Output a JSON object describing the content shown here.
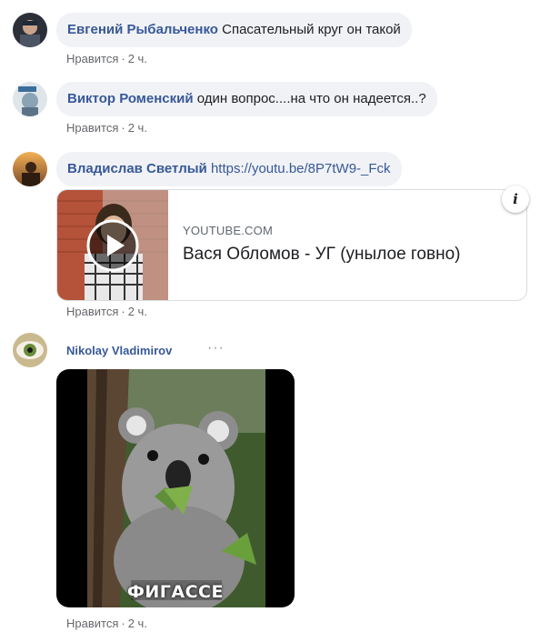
{
  "comments": [
    {
      "author": "Евгений Рыбальченко",
      "text": "Спасательный круг он такой",
      "like": "Нравится",
      "sep": "·",
      "time": "2 ч."
    },
    {
      "author": "Виктор Роменский",
      "text": "один вопрос....на что он надеется..?",
      "like": "Нравится",
      "sep": "·",
      "time": "2 ч.",
      "avatar_badge": "# ЗА МИР"
    },
    {
      "author": "Владислав Светлый",
      "link": "https://youtu.be/8P7tW9-_Fck",
      "like": "Нравится",
      "sep": "·",
      "time": "2 ч.",
      "preview": {
        "domain": "YOUTUBE.COM",
        "title": "Вася Обломов - УГ (унылое говно)",
        "info_icon": "i",
        "play_icon": "play-icon"
      }
    },
    {
      "author": "Nikolay Vladimirov",
      "more": "···",
      "like": "Нравится",
      "sep": "·",
      "time": "2 ч.",
      "image_caption": "ФИГАССЕ"
    }
  ],
  "colors": {
    "link": "#385898",
    "bubble": "#f0f2f5",
    "meta": "#65676b"
  }
}
